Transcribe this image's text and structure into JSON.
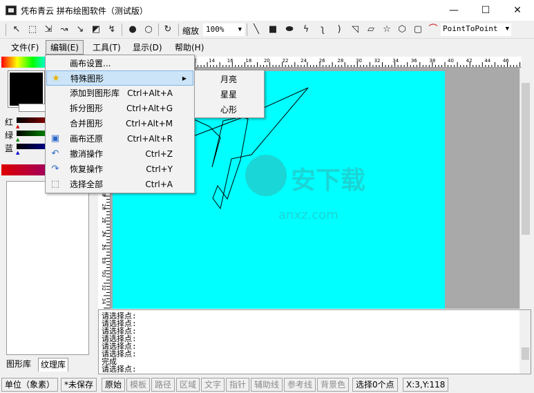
{
  "window": {
    "title": "凭布青云 拼布绘图软件（测试版）",
    "minimize": "—",
    "maximize": "☐",
    "close": "✕"
  },
  "toolbar": {
    "zoom_label": "缩放",
    "zoom_value": "100%",
    "shape_mode": "PointToPoint"
  },
  "menubar": {
    "items": [
      "文件(F)",
      "编辑(E)",
      "工具(T)",
      "显示(D)",
      "帮助(H)"
    ]
  },
  "color_panel": {
    "channels": [
      "红",
      "绿",
      "蓝"
    ],
    "channel_colors": [
      "#800000",
      "#008000",
      "#000080"
    ]
  },
  "left_tabs": [
    "图形库",
    "纹理库"
  ],
  "edit_menu": {
    "items": [
      {
        "label": "画布设置...",
        "shortcut": "",
        "icon": ""
      },
      {
        "label": "特殊图形",
        "shortcut": "",
        "icon": "star-icon",
        "submenu": true
      },
      {
        "label": "添加到图形库",
        "shortcut": "Ctrl+Alt+A",
        "icon": ""
      },
      {
        "label": "拆分图形",
        "shortcut": "Ctrl+Alt+G",
        "icon": ""
      },
      {
        "label": "合并图形",
        "shortcut": "Ctrl+Alt+M",
        "icon": ""
      },
      {
        "label": "画布还原",
        "shortcut": "Ctrl+Alt+R",
        "icon": "restore-icon"
      },
      {
        "label": "撤消操作",
        "shortcut": "Ctrl+Z",
        "icon": "undo-icon"
      },
      {
        "label": "恢复操作",
        "shortcut": "Ctrl+Y",
        "icon": "redo-icon"
      },
      {
        "label": "选择全部",
        "shortcut": "Ctrl+A",
        "icon": "select-all-icon"
      }
    ]
  },
  "special_shapes_menu": {
    "items": [
      "月亮",
      "星星",
      "心形"
    ]
  },
  "ruler_top_ticks": [
    "12",
    "14",
    "16",
    "18",
    "20",
    "22",
    "24",
    "26",
    "28",
    "30",
    "32",
    "34",
    "36",
    "38",
    "40",
    "42",
    "44",
    "46"
  ],
  "ruler_left_ticks": [
    "18",
    "20",
    "22",
    "24",
    "26",
    "28",
    "30",
    "32",
    "34"
  ],
  "console": {
    "lines": [
      "请选择点:",
      "请选择点:",
      "请选择点:",
      "请选择点:",
      "请选择点:",
      "请选择点:",
      "完成",
      "请选择点:"
    ]
  },
  "statusbar": {
    "unit": "单位（象素）",
    "save_state": "*未保存",
    "modes": [
      "原始",
      "模板",
      "路径",
      "区域",
      "文字",
      "指针",
      "辅助线",
      "参考线",
      "背景色"
    ],
    "selection": "选择0个点",
    "coords": "X:3,Y:118"
  }
}
